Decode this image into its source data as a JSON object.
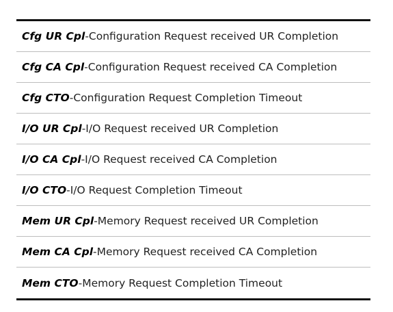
{
  "rows": [
    {
      "term": "Cfg UR Cpl",
      "separator": " - ",
      "description": "Configuration Request received UR Completion"
    },
    {
      "term": "Cfg CA Cpl",
      "separator": " - ",
      "description": "Configuration Request received CA Completion"
    },
    {
      "term": "Cfg CTO",
      "separator": " - ",
      "description": "Configuration Request Completion Timeout"
    },
    {
      "term": "I/O UR Cpl",
      "separator": " - ",
      "description": "I/O Request received UR Completion"
    },
    {
      "term": "I/O CA Cpl",
      "separator": " - ",
      "description": "I/O Request received CA Completion"
    },
    {
      "term": "I/O CTO",
      "separator": " - ",
      "description": "I/O Request Completion Timeout"
    },
    {
      "term": "Mem UR Cpl",
      "separator": " - ",
      "description": "Memory Request received UR Completion"
    },
    {
      "term": "Mem CA Cpl",
      "separator": " - ",
      "description": "Memory Request received CA Completion"
    },
    {
      "term": "Mem CTO",
      "separator": " - ",
      "description": "Memory Request Completion Timeout"
    }
  ]
}
